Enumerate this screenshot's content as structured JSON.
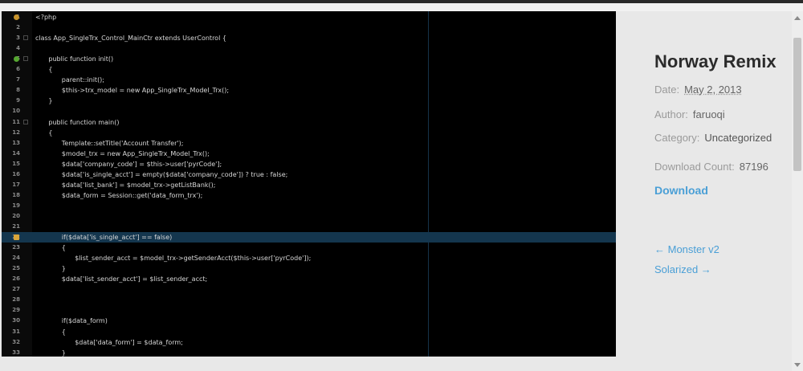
{
  "post": {
    "title": "Norway Remix",
    "date_label": "Date:",
    "date": "May 2, 2013",
    "author_label": "Author:",
    "author": "faruoqi",
    "category_label": "Category:",
    "category": "Uncategorized",
    "downloads_label": "Download Count:",
    "downloads": "87196",
    "download_link": "Download"
  },
  "nav": {
    "prev": "← Monster v2",
    "next": "Solarized →"
  },
  "editor": {
    "lines": [
      {
        "n": "1",
        "t": "<?php",
        "m": "bulb"
      },
      {
        "n": "2",
        "t": ""
      },
      {
        "n": "3",
        "t": "class App_SingleTrx_Control_MainCtr extends UserControl {",
        "fold": true
      },
      {
        "n": "4",
        "t": ""
      },
      {
        "n": "5",
        "t": "    public function init()",
        "m": "ok",
        "fold": true
      },
      {
        "n": "6",
        "t": "    {"
      },
      {
        "n": "7",
        "t": "        parent::init();"
      },
      {
        "n": "8",
        "t": "        $this->trx_model = new App_SingleTrx_Model_Trx();"
      },
      {
        "n": "9",
        "t": "    }"
      },
      {
        "n": "10",
        "t": ""
      },
      {
        "n": "11",
        "t": "    public function main()",
        "fold": true
      },
      {
        "n": "12",
        "t": "    {"
      },
      {
        "n": "13",
        "t": "        Template::setTitle('Account Transfer');"
      },
      {
        "n": "14",
        "t": "        $model_trx = new App_SingleTrx_Model_Trx();"
      },
      {
        "n": "15",
        "t": "        $data['company_code'] = $this->user['pyrCode'];"
      },
      {
        "n": "16",
        "t": "        $data['is_single_acct'] = empty($data['company_code']) ? true : false;"
      },
      {
        "n": "17",
        "t": "        $data['list_bank'] = $model_trx->getListBank();"
      },
      {
        "n": "18",
        "t": "        $data_form = Session::get('data_form_trx');"
      },
      {
        "n": "19",
        "t": ""
      },
      {
        "n": "20",
        "t": ""
      },
      {
        "n": "21",
        "t": ""
      },
      {
        "n": "22",
        "t": "        if($data['is_single_acct'] == false)",
        "m": "warn",
        "hl": true
      },
      {
        "n": "23",
        "t": "        {"
      },
      {
        "n": "24",
        "t": "            $list_sender_acct = $model_trx->getSenderAcct($this->user['pyrCode']);"
      },
      {
        "n": "25",
        "t": "        }"
      },
      {
        "n": "26",
        "t": "        $data['list_sender_acct'] = $list_sender_acct;"
      },
      {
        "n": "27",
        "t": ""
      },
      {
        "n": "28",
        "t": ""
      },
      {
        "n": "29",
        "t": ""
      },
      {
        "n": "30",
        "t": "        if($data_form)"
      },
      {
        "n": "31",
        "t": "        {"
      },
      {
        "n": "32",
        "t": "            $data['data_form'] = $data_form;"
      },
      {
        "n": "33",
        "t": "        }"
      }
    ]
  }
}
